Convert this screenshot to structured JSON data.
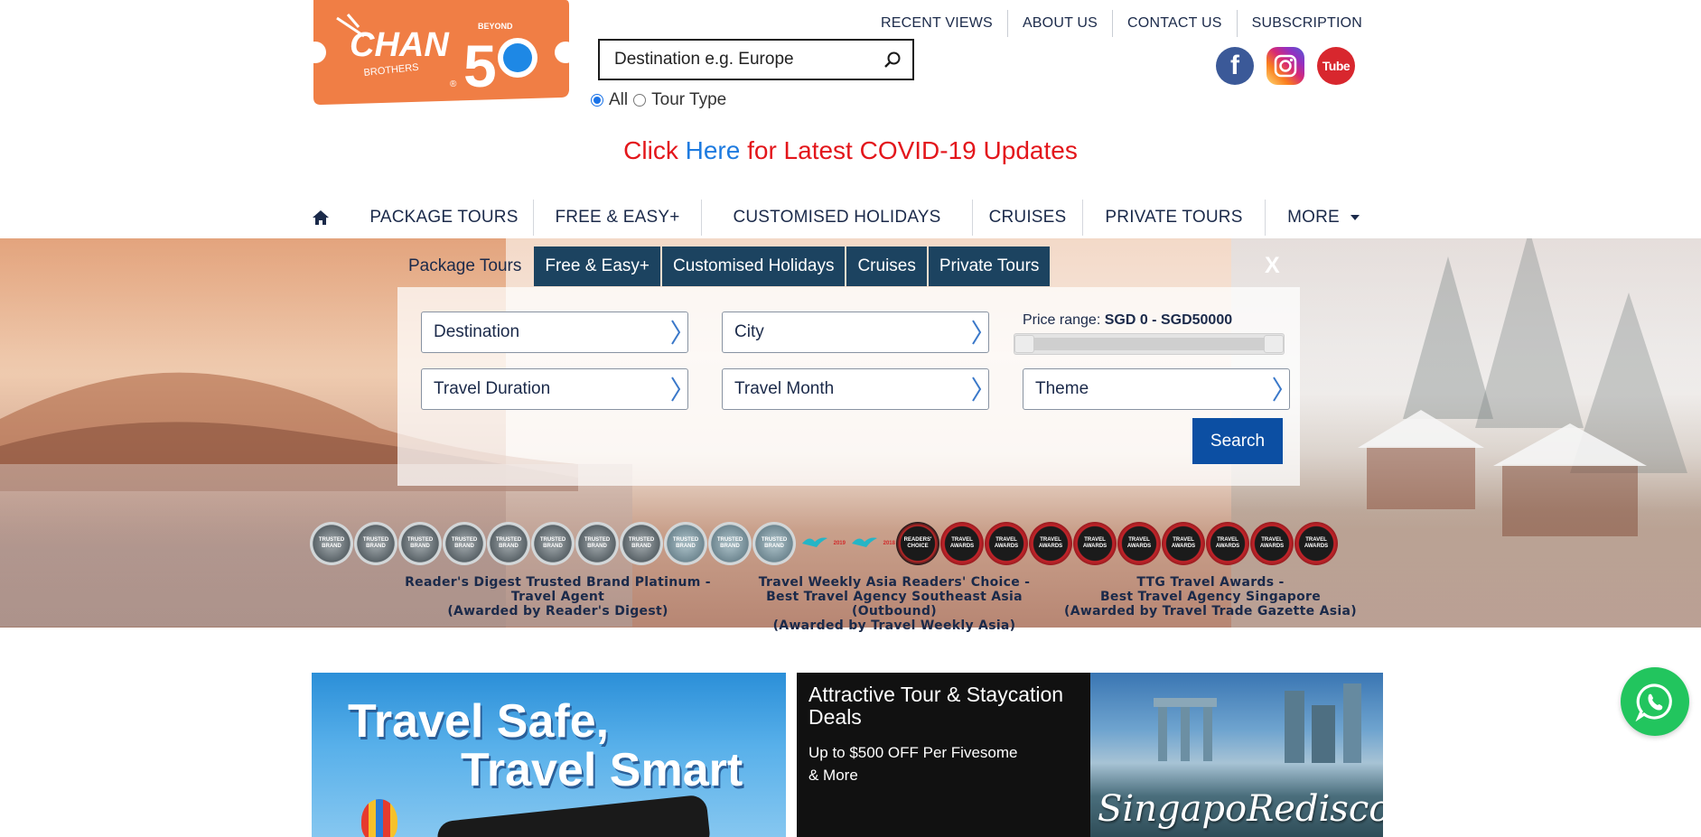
{
  "logo": {
    "text": "CHAN",
    "subtext": "BROTHERS",
    "reg": "®",
    "beyond": "BEYOND",
    "number": "50"
  },
  "search": {
    "placeholder": "Destination e.g. Europe",
    "value": "",
    "radio_all": "All",
    "radio_tour_type": "Tour Type",
    "selected": "All"
  },
  "top_links": [
    "RECENT VIEWS",
    "ABOUT US",
    "CONTACT US",
    "SUBSCRIPTION"
  ],
  "social": {
    "facebook": "f",
    "youtube": "Tube",
    "icons": [
      "facebook-icon",
      "instagram-icon",
      "youtube-icon"
    ]
  },
  "covid": {
    "prefix": "Click",
    "link": "Here",
    "suffix": "for Latest COVID-19 Updates"
  },
  "nav": {
    "items": [
      "PACKAGE TOURS",
      "FREE & EASY+",
      "CUSTOMISED HOLIDAYS",
      "CRUISES",
      "PRIVATE TOURS",
      "MORE"
    ]
  },
  "search_panel": {
    "tabs": [
      "Package Tours",
      "Free & Easy+",
      "Customised Holidays",
      "Cruises",
      "Private Tours"
    ],
    "active_tab": "Package Tours",
    "close": "X",
    "fields": {
      "destination": "Destination",
      "city": "City",
      "travel_duration": "Travel Duration",
      "travel_month": "Travel Month",
      "theme": "Theme"
    },
    "price_range_label": "Price range:",
    "price_range_value": "SGD 0 - SGD50000",
    "search_button": "Search",
    "price_min_fraction": 0,
    "price_max_fraction": 1
  },
  "awards": {
    "rd_badge_text": "TRUSTED BRAND",
    "tw_badge_text": "TRAVEL WEEKLY ASIA",
    "tw_years": [
      "2019",
      "2018"
    ],
    "tw_caption": "READERS' CHOICE",
    "ttg_badge_text": "TRAVEL AWARDS",
    "groups": [
      {
        "line1": "Reader's Digest Trusted Brand Platinum -",
        "line2": "Travel Agent",
        "line3": "(Awarded by Reader's Digest)"
      },
      {
        "line1": "Travel Weekly Asia Readers' Choice -",
        "line2": "Best Travel Agency Southeast Asia (Outbound)",
        "line3": "(Awarded by Travel Weekly Asia)"
      },
      {
        "line1": "TTG Travel Awards -",
        "line2": "Best Travel Agency Singapore",
        "line3": "(Awarded by Travel Trade Gazette Asia)"
      }
    ]
  },
  "promos": {
    "p1_line1": "Travel Safe,",
    "p1_line2": "Travel Smart",
    "p2_title": "Attractive Tour & Staycation Deals",
    "p2_sub": "Up to $500 OFF Per Fivesome & More",
    "p3_script": "SingapoRediscovers"
  },
  "colors": {
    "brand_orange": "#f07e45",
    "navy": "#1b2a4a",
    "tab_dark": "#1c4360",
    "search_blue": "#0c4fa3",
    "covid_red": "#e3161b",
    "link_blue": "#1e7be0",
    "whatsapp_green": "#22c55e"
  }
}
